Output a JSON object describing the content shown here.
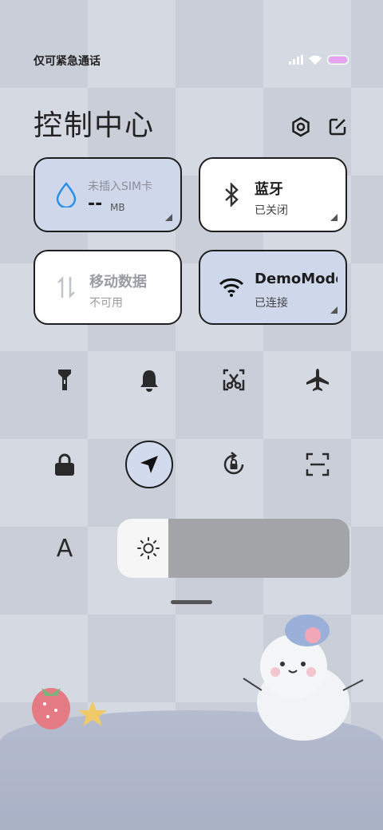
{
  "status_bar": {
    "carrier": "仅可紧急通话",
    "icons": [
      "signal-icon",
      "wifi-icon",
      "battery-icon"
    ]
  },
  "header": {
    "title": "控制中心",
    "settings_icon": "gear-icon",
    "edit_icon": "edit-icon"
  },
  "tiles": {
    "data_usage": {
      "title": "未插入SIM卡",
      "value": "--",
      "unit": "MB",
      "icon": "water-drop-icon"
    },
    "bluetooth": {
      "title": "蓝牙",
      "subtitle": "已关闭",
      "icon": "bluetooth-icon"
    },
    "mobile_data": {
      "title": "移动数据",
      "subtitle": "不可用",
      "icon": "mobile-data-icon"
    },
    "wifi": {
      "title": "DemoMode",
      "subtitle": "已连接",
      "icon": "wifi-icon"
    }
  },
  "quick_toggles": [
    {
      "name": "flashlight",
      "icon": "flashlight-icon",
      "active": false
    },
    {
      "name": "ring",
      "icon": "bell-icon",
      "active": false
    },
    {
      "name": "screenshot",
      "icon": "scissors-icon",
      "active": false
    },
    {
      "name": "airplane",
      "icon": "airplane-icon",
      "active": false
    },
    {
      "name": "lock",
      "icon": "lock-icon",
      "active": false
    },
    {
      "name": "location",
      "icon": "location-arrow-icon",
      "active": true
    },
    {
      "name": "rotation-lock",
      "icon": "rotate-lock-icon",
      "active": false
    },
    {
      "name": "scanner",
      "icon": "scan-icon",
      "active": false
    }
  ],
  "brightness": {
    "auto_label": "A",
    "level": 0.22,
    "icon": "sun-icon"
  },
  "colors": {
    "accent_blue": "#2b8fe8",
    "tile_active": "#cfd8ea",
    "tile_white": "#ffffff"
  }
}
